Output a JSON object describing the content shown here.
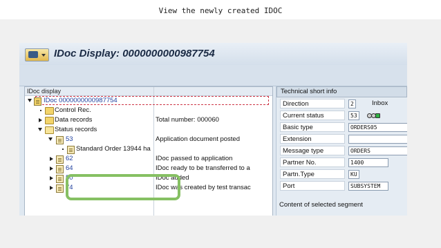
{
  "slide": {
    "caption": "View the newly created IDOC"
  },
  "window": {
    "title": "IDoc Display: 0000000000987754"
  },
  "tree": {
    "header": "IDoc display",
    "root": "IDoc 0000000000987754",
    "control_rec": "Control Rec.",
    "data_records": {
      "label": "Data records",
      "desc": "Total number: 000060"
    },
    "status_records": "Status records",
    "statuses": [
      {
        "code": "53",
        "desc": "Application document posted"
      },
      {
        "code": "62",
        "desc": "IDoc passed to application"
      },
      {
        "code": "64",
        "desc": "IDoc ready to be transferred to a"
      },
      {
        "code": "50",
        "desc": "IDoc added"
      },
      {
        "code": "74",
        "desc": "IDoc was created by test transac"
      }
    ],
    "child_of_53": "Standard Order 13944 ha"
  },
  "technical_info": {
    "title": "Technical short info",
    "direction": {
      "label": "Direction",
      "value": "2",
      "text": "Inbox"
    },
    "current_status": {
      "label": "Current status",
      "value": "53"
    },
    "basic_type": {
      "label": "Basic type",
      "value": "ORDERS05"
    },
    "extension": {
      "label": "Extension",
      "value": ""
    },
    "message_type": {
      "label": "Message type",
      "value": "ORDERS"
    },
    "partner_no": {
      "label": "Partner No.",
      "value": "1400"
    },
    "partn_type": {
      "label": "Partn.Type",
      "value": "KU"
    },
    "port": {
      "label": "Port",
      "value": "SUBSYSTEM"
    }
  },
  "content_section": {
    "label": "Content of selected segment"
  },
  "colors": {
    "highlight": "#86c063",
    "status_leds": [
      "#d0d0d0",
      "#d0d0d0",
      "#2fb344"
    ]
  },
  "icons": [
    "menu-icon",
    "folder-icon",
    "document-icon",
    "status-light-icon",
    "expand-arrow-icon",
    "collapse-arrow-icon"
  ]
}
